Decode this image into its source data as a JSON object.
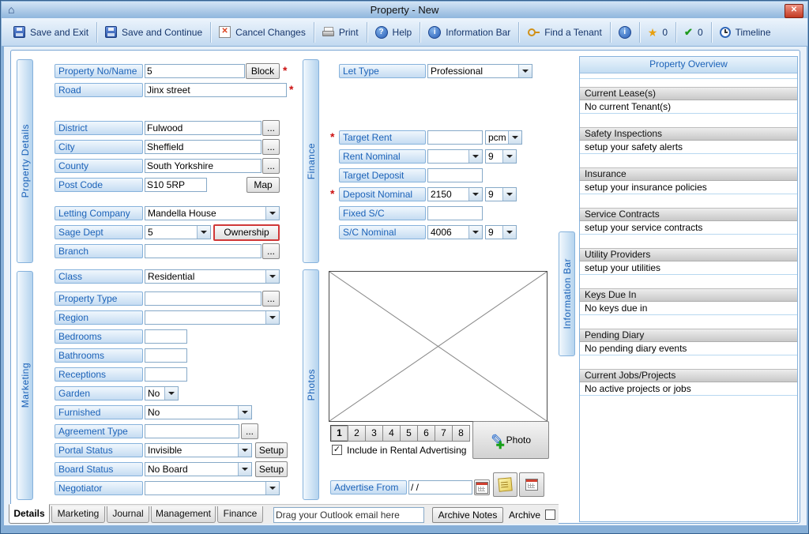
{
  "window": {
    "title": "Property  - New"
  },
  "icons": {
    "house": "⌂",
    "close": "✕",
    "cancel_x": "✕",
    "help": "?",
    "info": "i",
    "star": "★",
    "check": "✔",
    "pencil": "✎",
    "plus": "✚",
    "checkbox_check": "✓"
  },
  "required_marker": "*",
  "toolbar": {
    "save_exit": "Save and Exit",
    "save_continue": "Save and Continue",
    "cancel_changes": "Cancel Changes",
    "print": "Print",
    "help": "Help",
    "information_bar": "Information Bar",
    "find_tenant": "Find a Tenant",
    "star_count": "0",
    "check_count": "0",
    "timeline": "Timeline"
  },
  "side_tabs": {
    "property_details": "Property Details",
    "marketing": "Marketing",
    "finance": "Finance",
    "photos": "Photos",
    "information_bar": "Information Bar"
  },
  "details": {
    "property_no": {
      "label": "Property No/Name",
      "value": "5",
      "button": "Block"
    },
    "road": {
      "label": "Road",
      "value": "Jinx street"
    },
    "district": {
      "label": "District",
      "value": "Fulwood",
      "button": "..."
    },
    "city": {
      "label": "City",
      "value": "Sheffield",
      "button": "..."
    },
    "county": {
      "label": "County",
      "value": "South Yorkshire",
      "button": "..."
    },
    "post_code": {
      "label": "Post Code",
      "value": "S10 5RP",
      "button": "Map"
    },
    "letting_company": {
      "label": "Letting Company",
      "value": "Mandella House"
    },
    "sage_dept": {
      "label": "Sage Dept",
      "value": "5",
      "button": "Ownership"
    },
    "branch": {
      "label": "Branch",
      "value": "",
      "button": "..."
    },
    "class": {
      "label": "Class",
      "value": "Residential"
    },
    "property_type": {
      "label": "Property Type",
      "value": "",
      "button": "..."
    },
    "region": {
      "label": "Region",
      "value": ""
    },
    "bedrooms": {
      "label": "Bedrooms",
      "value": ""
    },
    "bathrooms": {
      "label": "Bathrooms",
      "value": ""
    },
    "receptions": {
      "label": "Receptions",
      "value": ""
    },
    "garden": {
      "label": "Garden",
      "value": "No"
    },
    "furnished": {
      "label": "Furnished",
      "value": "No"
    },
    "agreement_type": {
      "label": "Agreement Type",
      "value": "",
      "button": "..."
    },
    "portal_status": {
      "label": "Portal Status",
      "value": "Invisible",
      "button": "Setup"
    },
    "board_status": {
      "label": "Board Status",
      "value": "No Board",
      "button": "Setup"
    },
    "negotiator": {
      "label": "Negotiator",
      "value": ""
    }
  },
  "finance": {
    "let_type": {
      "label": "Let Type",
      "value": "Professional"
    },
    "target_rent": {
      "label": "Target Rent",
      "value": "",
      "unit": "pcm"
    },
    "rent_nominal": {
      "label": "Rent Nominal",
      "value": "",
      "code": "9"
    },
    "target_deposit": {
      "label": "Target Deposit",
      "value": ""
    },
    "deposit_nominal": {
      "label": "Deposit Nominal",
      "value": "2150",
      "code": "9"
    },
    "fixed_sc": {
      "label": "Fixed S/C",
      "value": ""
    },
    "sc_nominal": {
      "label": "S/C Nominal",
      "value": "4006",
      "code": "9"
    }
  },
  "photos": {
    "slots": [
      "1",
      "2",
      "3",
      "4",
      "5",
      "6",
      "7",
      "8"
    ],
    "photo_button": "Photo",
    "include_label": "Include in  Rental Advertising",
    "advertise_from_label": "Advertise From",
    "advertise_from_value": "/ /"
  },
  "overview": {
    "title": "Property Overview",
    "sections": [
      {
        "header": "Current Lease(s)",
        "text": "No current Tenant(s)"
      },
      {
        "header": "Safety Inspections",
        "text": "setup your safety alerts"
      },
      {
        "header": "Insurance",
        "text": "setup your insurance policies"
      },
      {
        "header": "Service Contracts",
        "text": "setup your service contracts"
      },
      {
        "header": "Utility Providers",
        "text": "setup your utilities"
      },
      {
        "header": "Keys Due In",
        "text": "No keys due in"
      },
      {
        "header": "Pending Diary",
        "text": "No pending diary events"
      },
      {
        "header": "Current Jobs/Projects",
        "text": "No active projects or jobs"
      }
    ]
  },
  "bottom_tabs": [
    "Details",
    "Marketing",
    "Journal",
    "Management",
    "Finance"
  ],
  "bottom_bar": {
    "outlook_text": "Drag your Outlook email here",
    "archive_notes": "Archive Notes",
    "archive_label": "Archive"
  }
}
